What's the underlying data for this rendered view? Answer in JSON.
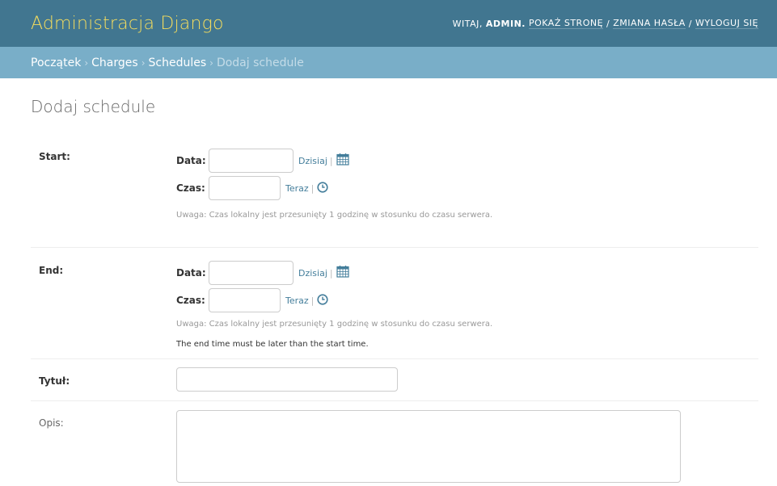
{
  "header": {
    "branding": "Administracja Django",
    "welcome": "WITAJ,",
    "username": "ADMIN.",
    "view_site": "POKAŻ STRONĘ",
    "sep": "/",
    "change_password": "ZMIANA HASŁA",
    "logout": "WYLOGUJ SIĘ"
  },
  "breadcrumbs": {
    "home": "Początek",
    "app": "Charges",
    "model": "Schedules",
    "current": "Dodaj schedule",
    "separator": "›"
  },
  "page_title": "Dodaj schedule",
  "form": {
    "start": {
      "label": "Start:",
      "date_label": "Data:",
      "date_value": "",
      "today_link": "Dzisiaj",
      "time_label": "Czas:",
      "time_value": "",
      "now_link": "Teraz",
      "help": "Uwaga: Czas lokalny jest przesunięty 1 godzinę w stosunku do czasu serwera."
    },
    "end": {
      "label": "End:",
      "date_label": "Data:",
      "date_value": "",
      "today_link": "Dzisiaj",
      "time_label": "Czas:",
      "time_value": "",
      "now_link": "Teraz",
      "help": "Uwaga: Czas lokalny jest przesunięty 1 godzinę w stosunku do czasu serwera.",
      "note": "The end time must be later than the start time."
    },
    "title": {
      "label": "Tytuł:",
      "value": ""
    },
    "description": {
      "label": "Opis:",
      "value": ""
    },
    "pipe": "|"
  },
  "icons": {
    "calendar": "calendar-icon",
    "clock": "clock-icon"
  },
  "colors": {
    "header_bg": "#417690",
    "branding": "#f5dd5d",
    "breadcrumb_bg": "#79aec8",
    "link": "#447e9b"
  }
}
